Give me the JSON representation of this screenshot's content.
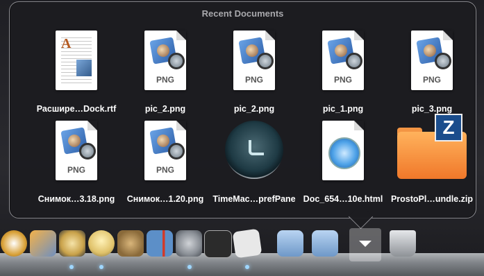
{
  "stack": {
    "title": "Recent Documents",
    "items": [
      {
        "label": "Расшире…Dock.rtf",
        "kind": "rtf"
      },
      {
        "label": "pic_2.png",
        "kind": "png"
      },
      {
        "label": "pic_2.png",
        "kind": "png"
      },
      {
        "label": "pic_1.png",
        "kind": "png"
      },
      {
        "label": "pic_3.png",
        "kind": "png"
      },
      {
        "label": "Снимок…3.18.png",
        "kind": "png"
      },
      {
        "label": "Снимок…1.20.png",
        "kind": "png"
      },
      {
        "label": "TimeMac…prefPane",
        "kind": "prefpane"
      },
      {
        "label": "Doc_654…10e.html",
        "kind": "html"
      },
      {
        "label": "ProstoPl…undle.zip",
        "kind": "zip"
      }
    ],
    "png_badge": "PNG",
    "zip_badge": "Z",
    "rtf_cap": "A"
  },
  "dock": {
    "apps": [
      {
        "name": "dvd-player-icon",
        "color": "#d9a23a"
      },
      {
        "name": "iphoto-icon",
        "color": "#6f8fbf"
      },
      {
        "name": "imovie-icon",
        "color": "#c9a24a"
      },
      {
        "name": "tips-lightbulb-icon",
        "color": "#e0c26a"
      },
      {
        "name": "owl-icon",
        "color": "#8a6a3a"
      },
      {
        "name": "remote-desktop-icon",
        "color": "#5c8fc8"
      },
      {
        "name": "system-preferences-icon",
        "color": "#8a8f96"
      },
      {
        "name": "terminal-icon",
        "color": "#2b2b2b"
      },
      {
        "name": "textedit-icon",
        "color": "#e8e8e8"
      },
      {
        "name": "applications-folder-icon",
        "color": "#8fb8e6"
      },
      {
        "name": "downloads-folder-icon",
        "color": "#8fb8e6"
      },
      {
        "name": "trash-icon",
        "color": "#c9ccd0"
      }
    ]
  }
}
